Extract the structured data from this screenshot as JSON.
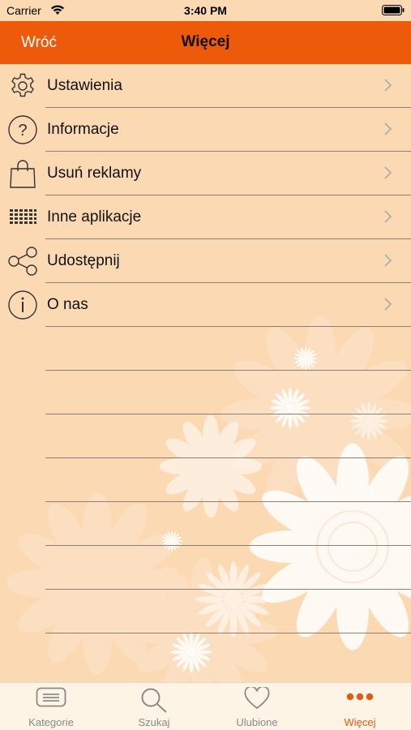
{
  "status_bar": {
    "carrier": "Carrier",
    "time": "3:40 PM"
  },
  "nav": {
    "back_label": "Wróć",
    "title": "Więcej"
  },
  "menu": {
    "items": [
      {
        "label": "Ustawienia",
        "icon": "gear-icon"
      },
      {
        "label": "Informacje",
        "icon": "question-circle-icon"
      },
      {
        "label": "Usuń reklamy",
        "icon": "shopping-bag-icon"
      },
      {
        "label": "Inne aplikacje",
        "icon": "apps-grid-icon"
      },
      {
        "label": "Udostępnij",
        "icon": "share-icon"
      },
      {
        "label": "O nas",
        "icon": "info-circle-icon"
      }
    ]
  },
  "tabs": [
    {
      "label": "Kategorie",
      "icon": "list-icon",
      "active": false
    },
    {
      "label": "Szukaj",
      "icon": "search-icon",
      "active": false
    },
    {
      "label": "Ulubione",
      "icon": "heart-icon",
      "active": false
    },
    {
      "label": "Więcej",
      "icon": "more-dots-icon",
      "active": true
    }
  ],
  "colors": {
    "accent": "#ec5a0a",
    "background": "#fbd9b3",
    "tab_active": "#e35a12",
    "tab_inactive": "#8a8a8a"
  }
}
